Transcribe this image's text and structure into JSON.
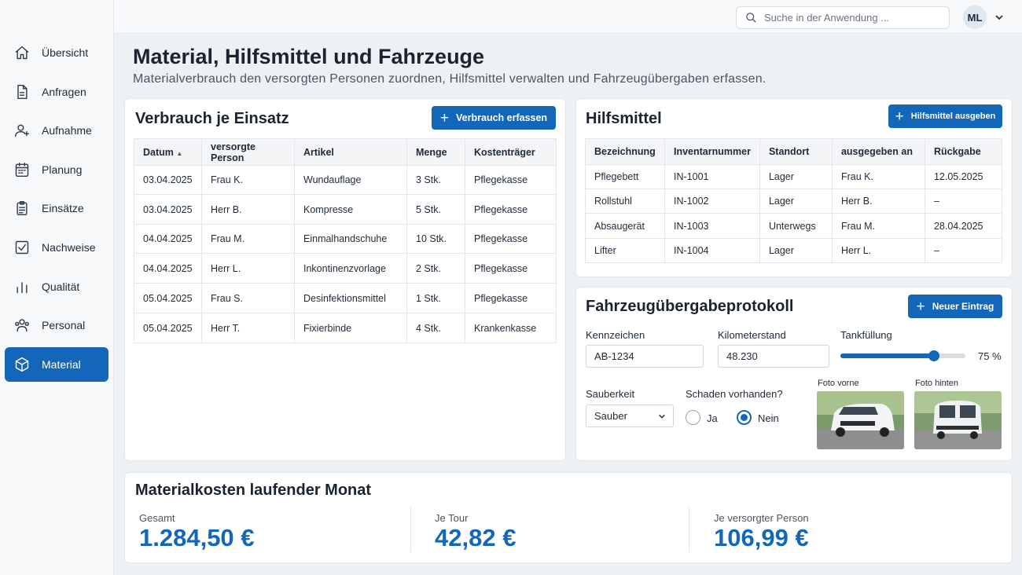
{
  "sidebar": {
    "items": [
      {
        "label": "Übersicht",
        "icon": "home-icon"
      },
      {
        "label": "Anfragen",
        "icon": "document-icon"
      },
      {
        "label": "Aufnahme",
        "icon": "user-plus-icon"
      },
      {
        "label": "Planung",
        "icon": "calendar-icon"
      },
      {
        "label": "Einsätze",
        "icon": "clipboard-icon"
      },
      {
        "label": "Nachweise",
        "icon": "checkbox-icon"
      },
      {
        "label": "Qualität",
        "icon": "bar-chart-icon"
      },
      {
        "label": "Personal",
        "icon": "users-icon"
      },
      {
        "label": "Material",
        "icon": "box-icon"
      }
    ],
    "active": "Material"
  },
  "topbar": {
    "search_placeholder": "Suche in der Anwendung ...",
    "avatar_initials": "ML"
  },
  "header": {
    "title": "Material, Hilfsmittel und Fahrzeuge",
    "subtitle": "Materialverbrauch den versorgten Personen zuordnen, Hilfsmittel verwalten und Fahrzeugübergaben erfassen."
  },
  "verbrauch": {
    "title": "Verbrauch je Einsatz",
    "button": "Verbrauch erfassen",
    "columns": [
      "Datum",
      "versorgte Person",
      "Artikel",
      "Menge",
      "Kostenträger"
    ],
    "sort_indicator": "▲",
    "rows": [
      [
        "03.04.2025",
        "Frau K.",
        "Wundauflage",
        "3 Stk.",
        "Pflegekasse"
      ],
      [
        "03.04.2025",
        "Herr B.",
        "Kompresse",
        "5 Stk.",
        "Pflegekasse"
      ],
      [
        "04.04.2025",
        "Frau M.",
        "Einmalhandschuhe",
        "10 Stk.",
        "Pflegekasse"
      ],
      [
        "04.04.2025",
        "Herr L.",
        "Inkontinenzvorlage",
        "2 Stk.",
        "Pflegekasse"
      ],
      [
        "05.04.2025",
        "Frau S.",
        "Desinfektionsmittel",
        "1 Stk.",
        "Pflegekasse"
      ],
      [
        "05.04.2025",
        "Herr T.",
        "Fixierbinde",
        "4 Stk.",
        "Krankenkasse"
      ]
    ]
  },
  "hilfsmittel": {
    "title": "Hilfsmittel",
    "button": "Hilfsmittel ausgeben",
    "columns": [
      "Bezeichnung",
      "Inventarnummer",
      "Standort",
      "ausgegeben an",
      "Rückgabe"
    ],
    "rows": [
      [
        "Pflegebett",
        "IN-1001",
        "Lager",
        "Frau K.",
        "12.05.2025"
      ],
      [
        "Rollstuhl",
        "IN-1002",
        "Lager",
        "Herr B.",
        "–"
      ],
      [
        "Absaugerät",
        "IN-1003",
        "Unterwegs",
        "Frau M.",
        "28.04.2025"
      ],
      [
        "Lifter",
        "IN-1004",
        "Lager",
        "Herr L.",
        "–"
      ]
    ]
  },
  "fahrzeug": {
    "title": "Fahrzeugübergabeprotokoll",
    "button": "Neuer Eintrag",
    "kennzeichen_label": "Kennzeichen",
    "kennzeichen_value": "AB-1234",
    "km_label": "Kilometerstand",
    "km_value": "48.230",
    "tank_label": "Tankfüllung",
    "tank_value": "75 %",
    "tank_fraction": 0.75,
    "sauberkeit_label": "Sauberkeit",
    "sauberkeit_value": "Sauber",
    "schaden_label": "Schaden vorhanden?",
    "schaden_options": [
      "Ja",
      "Nein"
    ],
    "schaden_selected": "Nein",
    "foto_vorne_label": "Foto vorne",
    "foto_hinten_label": "Foto hinten"
  },
  "kosten": {
    "title": "Materialkosten laufender Monat",
    "kpis": [
      {
        "label": "Gesamt",
        "value": "1.284,50 €"
      },
      {
        "label": "Je Tour",
        "value": "42,82 €"
      },
      {
        "label": "Je versorgter Person",
        "value": "106,99 €"
      }
    ]
  },
  "colors": {
    "accent": "#1467b8",
    "background": "#eef1f4",
    "card": "#ffffff"
  }
}
